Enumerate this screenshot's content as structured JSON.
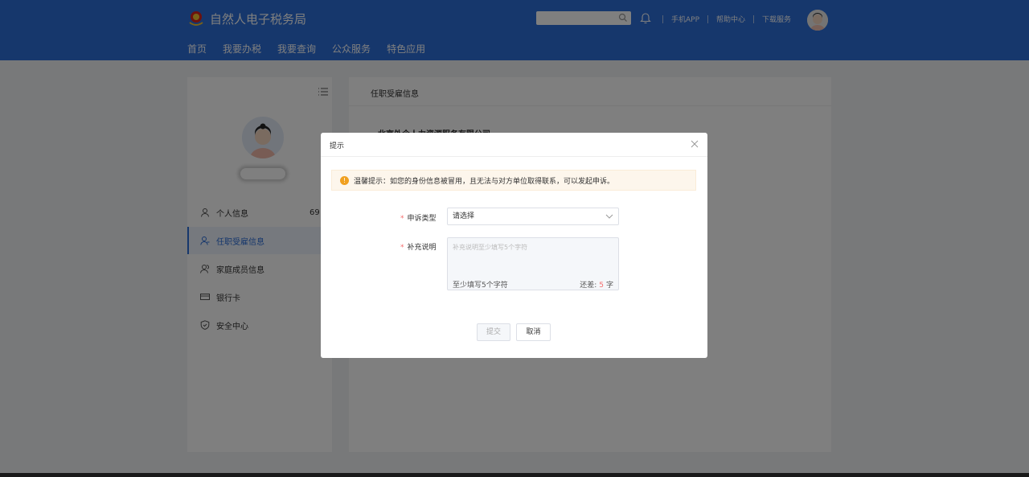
{
  "header": {
    "logo_text": "自然人电子税务局",
    "nav": [
      "首页",
      "我要办税",
      "我要查询",
      "公众服务",
      "特色应用"
    ],
    "links": [
      "手机APP",
      "帮助中心",
      "下载服务"
    ],
    "search_placeholder": ""
  },
  "sidebar": {
    "items": [
      {
        "label": "个人信息",
        "count": "69"
      },
      {
        "label": "任职受雇信息"
      },
      {
        "label": "家庭成员信息"
      },
      {
        "label": "银行卡"
      },
      {
        "label": "安全中心"
      }
    ]
  },
  "main": {
    "title": "任职受雇信息",
    "company": "北京外企人力资源服务有限公司"
  },
  "dialog": {
    "title": "提示",
    "tip": "温馨提示：如您的身份信息被冒用，且无法与对方单位取得联系，可以发起申诉。",
    "type_label": "申诉类型",
    "type_value": "请选择",
    "desc_label": "补充说明",
    "desc_placeholder": "补充说明至少填写5个字符",
    "min_hint": "至少填写5个字符",
    "remain_prefix": "还差:",
    "remain_count": "5",
    "remain_suffix": "字",
    "submit": "提交",
    "cancel": "取消"
  },
  "colors": {
    "brand": "#2d6ed8",
    "required": "#f56c6c",
    "warning": "#f0a020"
  }
}
